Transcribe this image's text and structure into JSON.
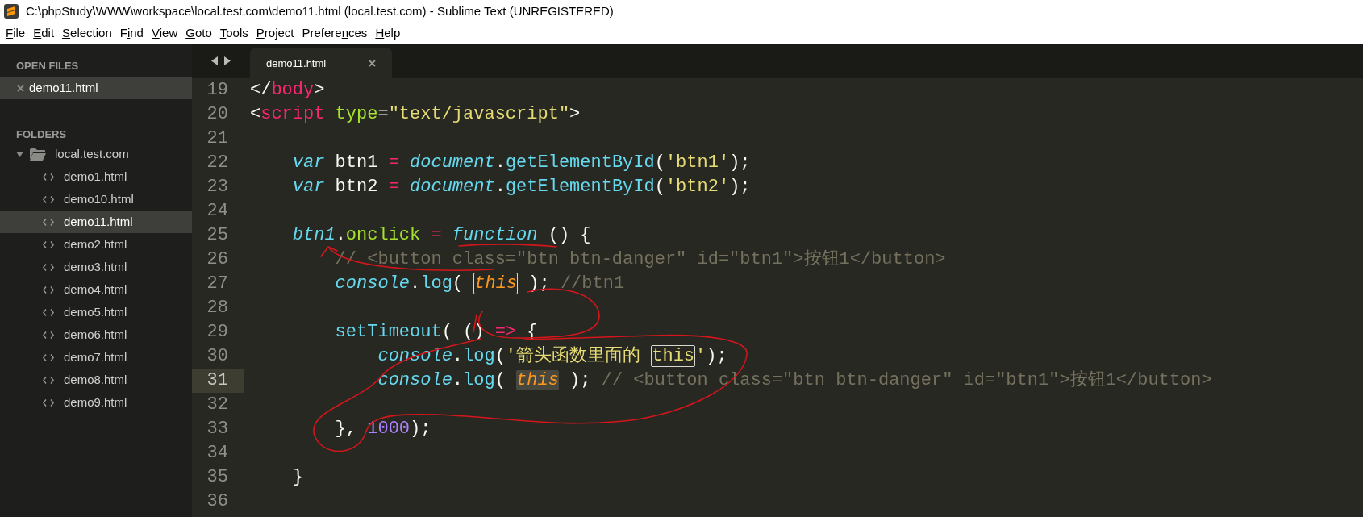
{
  "window": {
    "title": "C:\\phpStudy\\WWW\\workspace\\local.test.com\\demo11.html (local.test.com) - Sublime Text (UNREGISTERED)"
  },
  "menu": [
    {
      "mnemonic": "F",
      "rest": "ile"
    },
    {
      "mnemonic": "E",
      "rest": "dit"
    },
    {
      "mnemonic": "S",
      "rest": "election"
    },
    {
      "lead": "F",
      "mnemonic": "i",
      "rest": "nd"
    },
    {
      "mnemonic": "V",
      "rest": "iew"
    },
    {
      "mnemonic": "G",
      "rest": "oto"
    },
    {
      "mnemonic": "T",
      "rest": "ools"
    },
    {
      "mnemonic": "P",
      "rest": "roject"
    },
    {
      "lead": "Prefere",
      "mnemonic": "n",
      "rest": "ces"
    },
    {
      "mnemonic": "H",
      "rest": "elp"
    }
  ],
  "sidebar": {
    "open_files_heading": "OPEN FILES",
    "open_files": [
      {
        "name": "demo11.html",
        "selected": true
      }
    ],
    "folders_heading": "FOLDERS",
    "folders": [
      {
        "name": "local.test.com",
        "expanded": true,
        "children": [
          {
            "name": "demo1.html",
            "selected": false
          },
          {
            "name": "demo10.html",
            "selected": false
          },
          {
            "name": "demo11.html",
            "selected": true
          },
          {
            "name": "demo2.html",
            "selected": false
          },
          {
            "name": "demo3.html",
            "selected": false
          },
          {
            "name": "demo4.html",
            "selected": false
          },
          {
            "name": "demo5.html",
            "selected": false
          },
          {
            "name": "demo6.html",
            "selected": false
          },
          {
            "name": "demo7.html",
            "selected": false
          },
          {
            "name": "demo8.html",
            "selected": false
          },
          {
            "name": "demo9.html",
            "selected": false
          }
        ]
      }
    ]
  },
  "tabs": [
    {
      "label": "demo11.html",
      "selected": true
    }
  ],
  "editor": {
    "lines": [
      {
        "number": "19",
        "highlighted": false,
        "tokens": [
          {
            "text": "</",
            "kind": "plain"
          },
          {
            "text": "body",
            "kind": "tag"
          },
          {
            "text": ">",
            "kind": "plain"
          }
        ]
      },
      {
        "number": "20",
        "highlighted": false,
        "tokens": [
          {
            "text": "<",
            "kind": "plain"
          },
          {
            "text": "script",
            "kind": "tag"
          },
          {
            "text": " type",
            "kind": "attr"
          },
          {
            "text": "=",
            "kind": "plain"
          },
          {
            "text": "\"text/javascript\"",
            "kind": "string"
          },
          {
            "text": ">",
            "kind": "plain"
          }
        ]
      },
      {
        "number": "21",
        "highlighted": false
      },
      {
        "number": "22",
        "highlighted": false,
        "tokens": [
          {
            "text": "    var",
            "kind": "storage"
          },
          {
            "text": " btn1 ",
            "kind": "plain"
          },
          {
            "text": "=",
            "kind": "operator"
          },
          {
            "text": " document",
            "kind": "storage"
          },
          {
            "text": ".",
            "kind": "plain"
          },
          {
            "text": "getElementById",
            "kind": "function"
          },
          {
            "text": "(",
            "kind": "plain"
          },
          {
            "text": "'btn1'",
            "kind": "string"
          },
          {
            "text": ");",
            "kind": "plain"
          }
        ]
      },
      {
        "number": "23",
        "highlighted": false,
        "tokens": [
          {
            "text": "    var",
            "kind": "storage"
          },
          {
            "text": " btn2 ",
            "kind": "plain"
          },
          {
            "text": "=",
            "kind": "operator"
          },
          {
            "text": " document",
            "kind": "storage"
          },
          {
            "text": ".",
            "kind": "plain"
          },
          {
            "text": "getElementById",
            "kind": "function"
          },
          {
            "text": "(",
            "kind": "plain"
          },
          {
            "text": "'btn2'",
            "kind": "string"
          },
          {
            "text": ");",
            "kind": "plain"
          }
        ]
      },
      {
        "number": "24",
        "highlighted": false
      },
      {
        "number": "25",
        "highlighted": false,
        "tokens": [
          {
            "text": "    btn1",
            "kind": "storage"
          },
          {
            "text": ".",
            "kind": "plain"
          },
          {
            "text": "onclick",
            "kind": "attr"
          },
          {
            "text": " = ",
            "kind": "operator"
          },
          {
            "text": "function",
            "kind": "storage"
          },
          {
            "text": " () {",
            "kind": "plain"
          }
        ]
      },
      {
        "number": "26",
        "highlighted": false,
        "tokens": [
          {
            "text": "        // <button class=\"btn btn-danger\" id=\"btn1\">按钮1</button>",
            "kind": "comment"
          }
        ]
      },
      {
        "number": "27",
        "highlighted": false,
        "tokens": [
          {
            "text": "        console",
            "kind": "storage"
          },
          {
            "text": ".",
            "kind": "plain"
          },
          {
            "text": "log",
            "kind": "function"
          },
          {
            "text": "( ",
            "kind": "plain"
          },
          {
            "text": "this",
            "kind": "this",
            "outlined": true,
            "match": false
          },
          {
            "text": " ); ",
            "kind": "plain"
          },
          {
            "text": "//btn1",
            "kind": "comment"
          }
        ]
      },
      {
        "number": "28",
        "highlighted": false
      },
      {
        "number": "29",
        "highlighted": false,
        "tokens": [
          {
            "text": "        setTimeout",
            "kind": "function"
          },
          {
            "text": "( () ",
            "kind": "plain"
          },
          {
            "text": "=>",
            "kind": "operator"
          },
          {
            "text": " {",
            "kind": "plain"
          }
        ]
      },
      {
        "number": "30",
        "highlighted": false,
        "tokens": [
          {
            "text": "            console",
            "kind": "storage"
          },
          {
            "text": ".",
            "kind": "plain"
          },
          {
            "text": "log",
            "kind": "function"
          },
          {
            "text": "(",
            "kind": "plain"
          },
          {
            "text": "'箭头函数里面的 ",
            "kind": "string"
          },
          {
            "text": "this",
            "kind": "string",
            "outlined": true,
            "match": false
          },
          {
            "text": "'",
            "kind": "string"
          },
          {
            "text": ");",
            "kind": "plain"
          }
        ]
      },
      {
        "number": "31",
        "highlighted": true,
        "tokens": [
          {
            "text": "            console",
            "kind": "storage"
          },
          {
            "text": ".",
            "kind": "plain"
          },
          {
            "text": "log",
            "kind": "function"
          },
          {
            "text": "( ",
            "kind": "plain"
          },
          {
            "text": "this",
            "kind": "this",
            "outlined": false,
            "match": true
          },
          {
            "text": " ); ",
            "kind": "plain"
          },
          {
            "text": "// <button class=\"btn btn-danger\" id=\"btn1\">按钮1</button>",
            "kind": "comment"
          }
        ]
      },
      {
        "number": "32",
        "highlighted": false
      },
      {
        "number": "33",
        "highlighted": false,
        "tokens": [
          {
            "text": "        }, ",
            "kind": "plain"
          },
          {
            "text": "1000",
            "kind": "number"
          },
          {
            "text": ");",
            "kind": "plain"
          }
        ]
      },
      {
        "number": "34",
        "highlighted": false
      },
      {
        "number": "35",
        "highlighted": false,
        "tokens": [
          {
            "text": "    }",
            "kind": "plain"
          }
        ]
      },
      {
        "number": "36",
        "highlighted": false
      }
    ]
  }
}
